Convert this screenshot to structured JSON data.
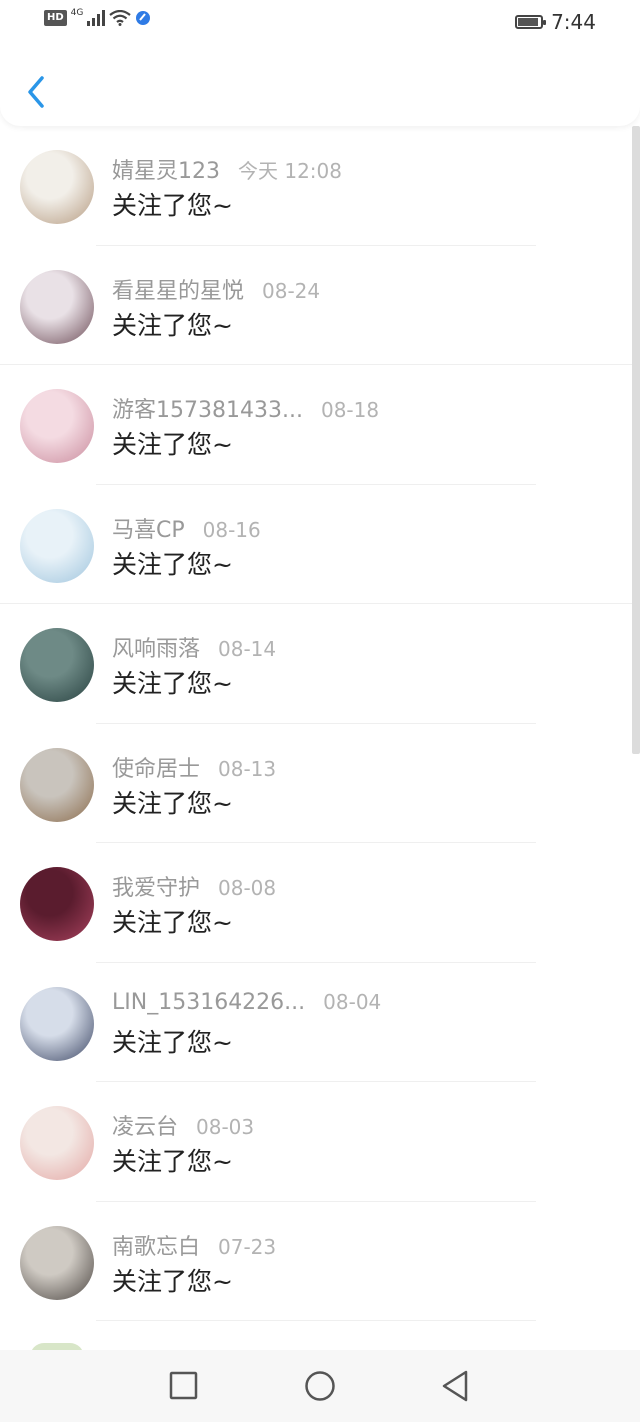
{
  "status_bar": {
    "hd": "HD",
    "network": "4G",
    "time": "7:44"
  },
  "message": "关注了您~",
  "list": [
    {
      "name": "婧星灵123",
      "date": "今天 12:08",
      "avatar_colors": [
        "#f2efe9",
        "#b59a80"
      ]
    },
    {
      "name": "看星星的星悦",
      "date": "08-24",
      "avatar_colors": [
        "#e9e1e6",
        "#6b4a55"
      ]
    },
    {
      "name": "游客157381433...",
      "date": "08-18",
      "avatar_colors": [
        "#f4dbe2",
        "#c98a9c"
      ]
    },
    {
      "name": "马喜CP",
      "date": "08-16",
      "avatar_colors": [
        "#e8f2f8",
        "#9ec4dd"
      ]
    },
    {
      "name": "风响雨落",
      "date": "08-14",
      "avatar_colors": [
        "#6e8a86",
        "#27403f"
      ]
    },
    {
      "name": "使命居士",
      "date": "08-13",
      "avatar_colors": [
        "#c9c4bd",
        "#8a6a4a"
      ]
    },
    {
      "name": "我爱守护",
      "date": "08-08",
      "avatar_colors": [
        "#5a1c2e",
        "#a9425e"
      ]
    },
    {
      "name": "LIN_153164226...",
      "date": "08-04",
      "avatar_colors": [
        "#d6dde9",
        "#3a4462"
      ]
    },
    {
      "name": "凌云台",
      "date": "08-03",
      "avatar_colors": [
        "#f3e7e3",
        "#e3a6a3"
      ]
    },
    {
      "name": "南歌忘白",
      "date": "07-23",
      "avatar_colors": [
        "#cfcac3",
        "#4a4440"
      ]
    }
  ]
}
